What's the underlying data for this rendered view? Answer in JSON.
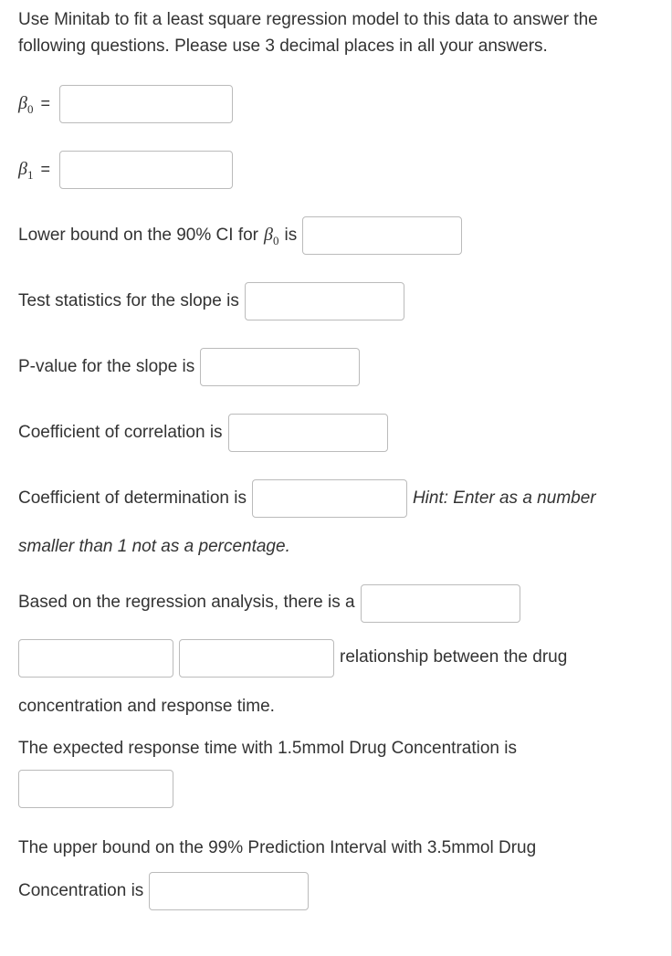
{
  "intro": "Use Minitab to fit a least square regression model to this data to answer the following questions. Please use 3 decimal places in all your answers.",
  "beta0": {
    "symbol": "β",
    "sub": "0",
    "eq": "="
  },
  "beta1": {
    "symbol": "β",
    "sub": "1",
    "eq": "="
  },
  "q_lowerbound_pre": "Lower bound on the 90% CI for ",
  "q_lowerbound_post": " is",
  "q_teststat": "Test statistics for the slope is",
  "q_pvalue": "P-value for the slope is",
  "q_corr": "Coefficient of correlation is",
  "q_det": "Coefficient of determination is",
  "hint_det": "Hint: Enter as a number",
  "hint_det2": "smaller than 1 not as a percentage.",
  "q_rel_pre": "Based on the regression analysis, there is a",
  "q_rel_mid": "relationship between the drug",
  "q_rel_post": "concentration and response time.",
  "q_expected": "The expected response time with 1.5mmol Drug Concentration is",
  "q_upper_pre": "The upper bound on the 99% Prediction Interval with 3.5mmol Drug",
  "q_upper_post": "Concentration is"
}
